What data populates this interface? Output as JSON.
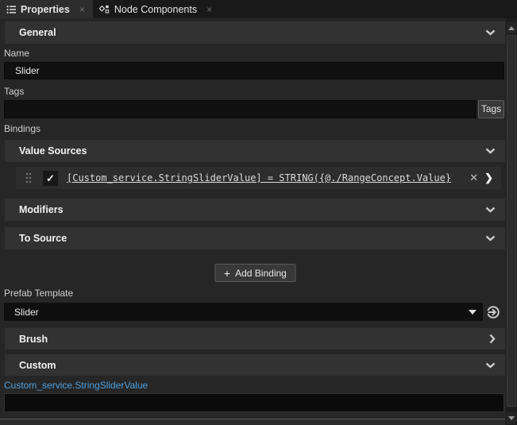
{
  "tabbar": {
    "tabs": [
      {
        "label": "Properties"
      },
      {
        "label": "Node Components"
      }
    ]
  },
  "icons": {
    "close": "×",
    "check": "✓",
    "row_close": "✕",
    "row_arrow": "❯",
    "plus": "+"
  },
  "general": {
    "title": "General",
    "name_label": "Name",
    "name_value": "Slider",
    "tags_label": "Tags",
    "tags_value": "",
    "tags_button_label": "Tags",
    "bindings_label": "Bindings"
  },
  "bindings": {
    "value_sources_title": "Value Sources",
    "expression": "[Custom_service.StringSliderValue] = STRING({@./RangeConcept.Value}",
    "modifiers_title": "Modifiers",
    "to_source_title": "To Source",
    "add_binding_label": "Add Binding"
  },
  "prefab": {
    "label": "Prefab Template",
    "value": "Slider"
  },
  "brush": {
    "title": "Brush"
  },
  "custom": {
    "title": "Custom",
    "property_label": "Custom_service.StringSliderValue",
    "property_value": ""
  },
  "colors": {
    "page_bg": "#262626",
    "header_bg": "#323232",
    "input_bg": "#101010",
    "accent_blue": "#4f9fdc"
  }
}
